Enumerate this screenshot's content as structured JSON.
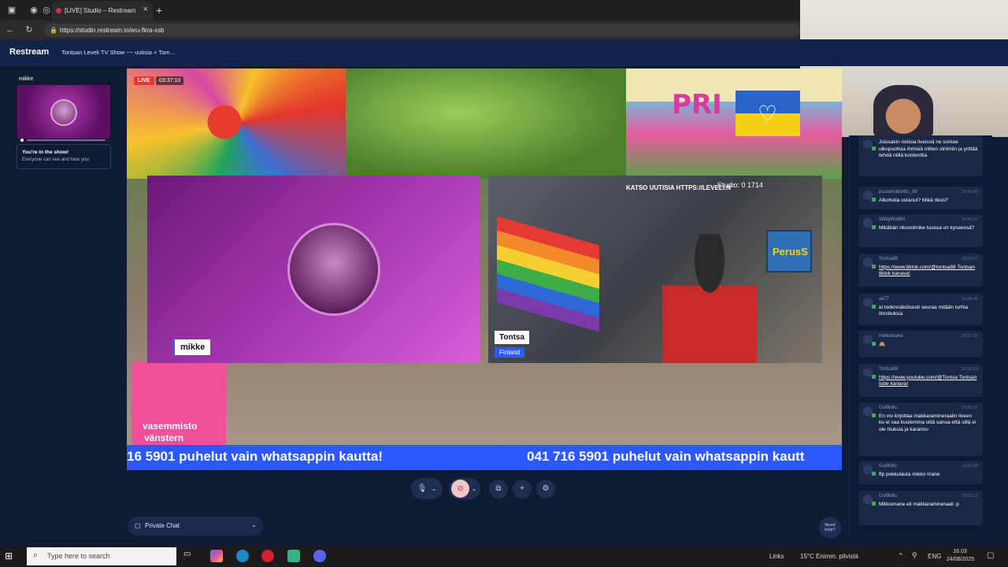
{
  "browser": {
    "tab_title": "[LIVE] Studio – Restream",
    "url": "https://studio.restream.io/eru-fkra-xsb"
  },
  "app": {
    "logo": "Restream",
    "show_title": "Tontsan Leveli TV Show ~~ uutisia + Tam..."
  },
  "sidebar": {
    "participant_name": "mikke",
    "info_title": "You're in the show!",
    "info_sub": "Everyone can see and hear you."
  },
  "stage": {
    "live_label": "LIVE",
    "live_time": "03:37:10",
    "tile1_name": "mikke",
    "tile2_name": "Tontsa",
    "tile2_location": "Finland",
    "katso_text": "KATSO UUTISIA HTTPS://LEVELI.N",
    "studio_text": "Studio: 0 1714",
    "perus_text": "PerusS",
    "pride_text": "PRI",
    "vasemmisto": "vasemmisto",
    "vanstern": "vänstern",
    "ticker_left": "16 5901 puhelut vain whatsappin kautta!",
    "ticker_right": "041 716 5901 puhelut vain whatsappin kautt"
  },
  "controls": {
    "private_chat": "Private Chat",
    "need_help": "Need help?"
  },
  "chat": [
    {
      "user": "",
      "time": "",
      "text": "Joissakin noissa liveissä ne sorkee ulkopuolisia ihmisiä niitten striimiin ja yrittää tehdä niillä kontenttia",
      "link": false
    },
    {
      "user": "puutarhatonttu_69",
      "time": "15:58:43",
      "text": "Alkoholia ostanut? Mikä rikos?",
      "link": false
    },
    {
      "user": "WildyWolf84",
      "time": "15:59:07",
      "text": "Mikähän rikosnimike tuossa on kyseessä?",
      "link": false
    },
    {
      "user": "Tontsa88",
      "time": "15:58:47",
      "text": "https://www.tiktok.com/@tontsa88 Tontsan tiktok kanava!",
      "link": true
    },
    {
      "user": "ak77",
      "time": "15:58:46",
      "text": "ei todennäköisesti seuraa mitään turhia ilmoituksia",
      "link": false
    },
    {
      "user": "mikkomane",
      "time": "15:57:32",
      "text": "🙈",
      "link": false
    },
    {
      "user": "Tontsa88",
      "time": "15:55:13",
      "text": "https://www.youtube.com/@Tontsa Tontsan tube kanava!",
      "link": true
    },
    {
      "user": "Gullibillu",
      "time": "15:55:07",
      "text": "En voi kirjottaa makkaramineraalin liveen ku ei saa kuulemma siitä sanoa että sillä ei ole hiuksia ja karannu",
      "link": false
    },
    {
      "user": "Gullibillu",
      "time": "15:55:05",
      "text": "ftp pokkulauta mikko mane",
      "link": false
    },
    {
      "user": "Gullibillu",
      "time": "15:53:13",
      "text": "Mikkomane eli makkaramineraali :p",
      "link": false
    }
  ],
  "taskbar": {
    "search_placeholder": "Type here to search",
    "links": "Links",
    "weather": "15°C  Enimm. pilvistä",
    "lang": "ENG",
    "time": "16.03",
    "date": "24/08/2025"
  },
  "colors": {
    "accent_blue": "#2b59ff",
    "live_red": "#e53935",
    "app_bg": "#0f1b33"
  }
}
